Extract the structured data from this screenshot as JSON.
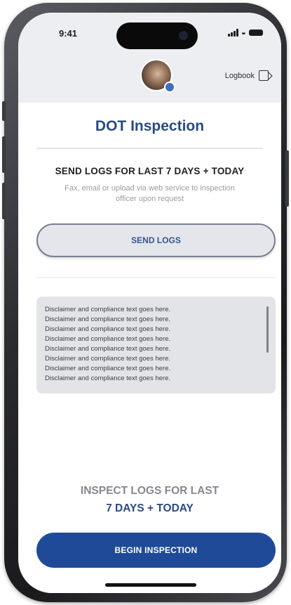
{
  "status_bar": {
    "time": "9:41"
  },
  "header": {
    "logbook_label": "Logbook",
    "logbook_icon": "logbook-exit-icon",
    "avatar_badge_color": "#3e6fb8"
  },
  "page": {
    "title": "DOT Inspection",
    "section_heading": "SEND LOGS FOR LAST 7 DAYS + TODAY",
    "section_description": "Fax, email or upload via web service to inspection officer upon request",
    "send_logs_label": "SEND LOGS"
  },
  "disclaimer": {
    "lines": [
      "Disclaimer and compliance text goes here.",
      "Disclaimer and compliance text goes here.",
      "Disclaimer and compliance text goes here.",
      "Disclaimer and compliance text goes here.",
      "Disclaimer and compliance text goes here.",
      "Disclaimer and compliance text goes here.",
      "Disclaimer and compliance text goes here.",
      "Disclaimer and compliance text goes here."
    ]
  },
  "inspect": {
    "heading_line1": "INSPECT LOGS FOR LAST",
    "heading_line2": "7 DAYS + TODAY",
    "begin_label": "BEGIN INSPECTION"
  },
  "colors": {
    "primary": "#1f4a98",
    "title": "#2a4a86",
    "header_bg": "#eceef1"
  }
}
